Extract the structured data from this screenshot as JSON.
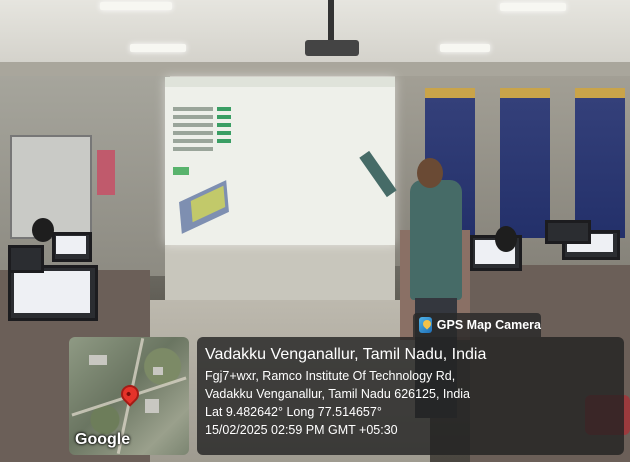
{
  "overlay": {
    "app_name": "GPS Map Camera",
    "app_icon": "gps-map-camera-icon",
    "place_title": "Vadakku Venganallur, Tamil Nadu, India",
    "address_line_1": "Fgj7+wxr, Ramco Institute Of Technology Rd,",
    "address_line_2": "Vadakku Venganallur, Tamil Nadu 626125, India",
    "coordinates": "Lat 9.482642° Long 77.514657°",
    "datetime": "15/02/2025 02:59 PM GMT +05:30",
    "map_label": "Google",
    "pin_icon": "map-pin-icon",
    "pin_color": "#e5332a"
  }
}
